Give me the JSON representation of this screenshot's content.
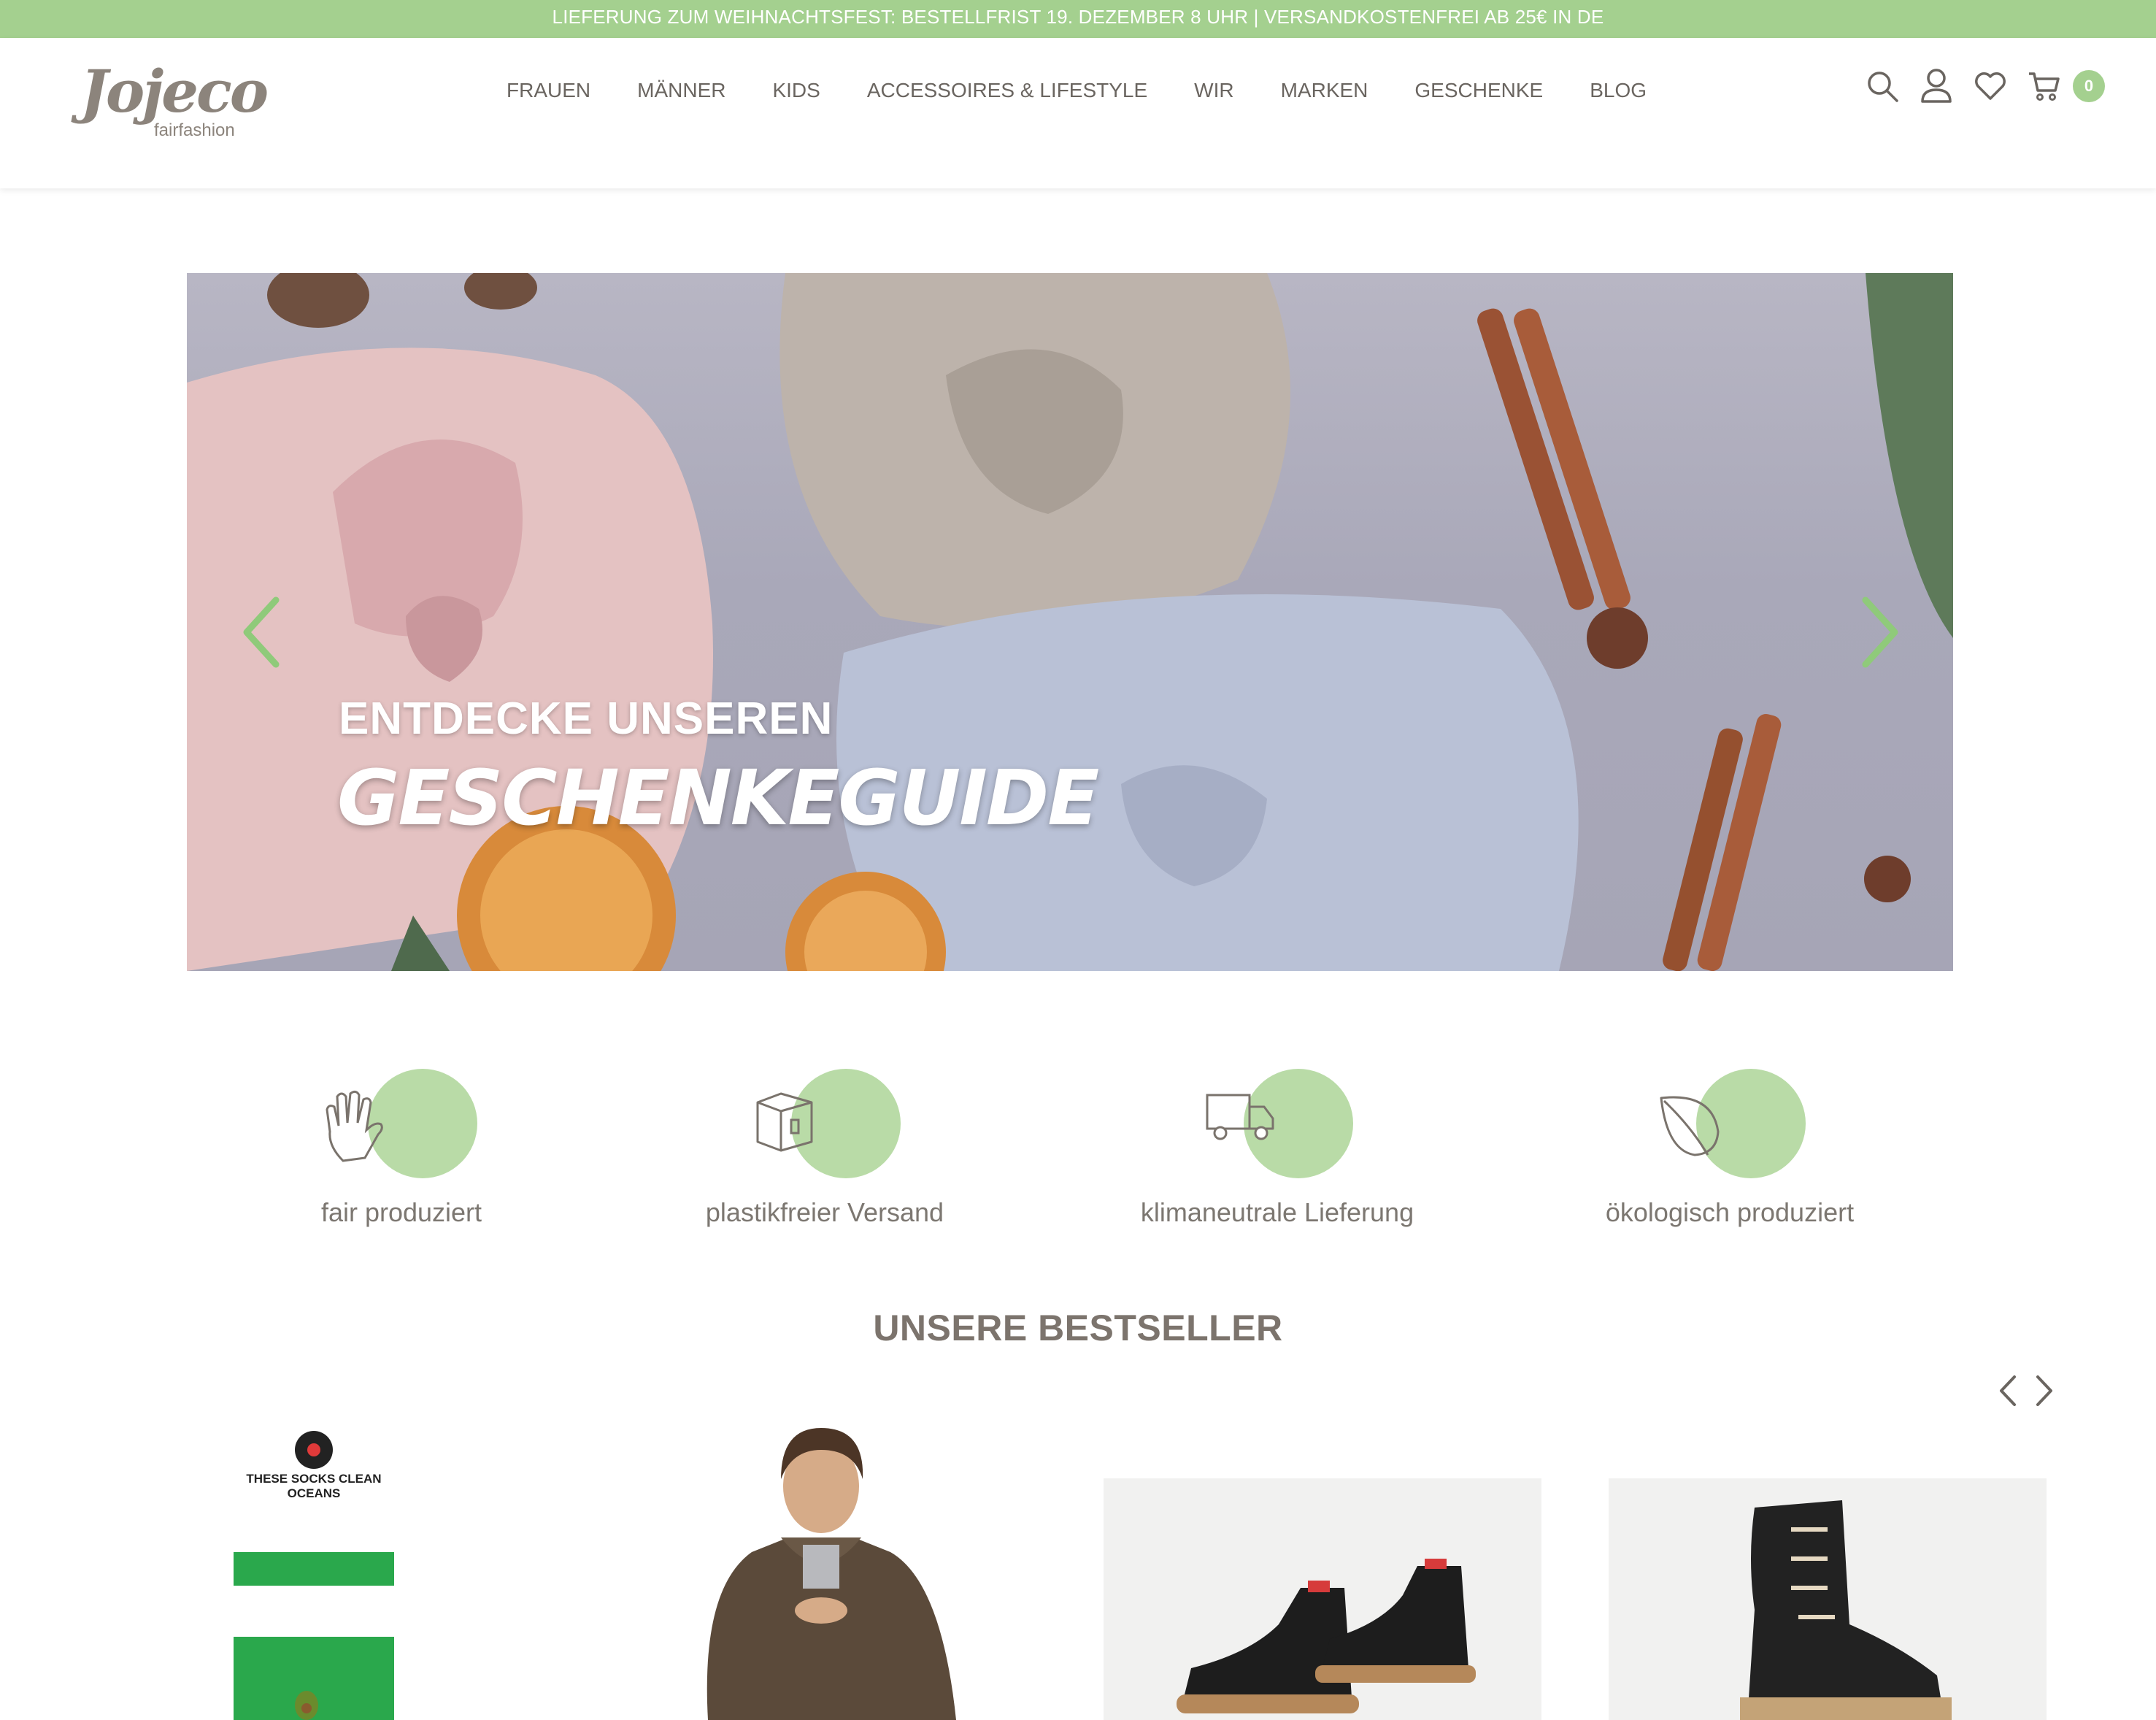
{
  "topbar": {
    "text": "LIEFERUNG ZUM WEIHNACHTSFEST: BESTELLFRIST 19. DEZEMBER 8 UHR | VERSANDKOSTENFREI AB 25€ IN DE"
  },
  "logo": {
    "wordmark": "Jojeco",
    "tagline": "fairfashion"
  },
  "nav": [
    {
      "label": "FRAUEN"
    },
    {
      "label": "MÄNNER"
    },
    {
      "label": "KIDS"
    },
    {
      "label": "ACCESSOIRES & LIFESTYLE"
    },
    {
      "label": "WIR"
    },
    {
      "label": "MARKEN"
    },
    {
      "label": "GESCHENKE"
    },
    {
      "label": "BLOG"
    }
  ],
  "header_icons": [
    "search-icon",
    "user-icon",
    "heart-icon",
    "cart-icon"
  ],
  "cart": {
    "count": "0"
  },
  "hero": {
    "line1": "ENTDECKE UNSEREN",
    "line2": "GESCHENKEGUIDE"
  },
  "features": [
    {
      "label": "fair produziert",
      "icon": "hand-icon"
    },
    {
      "label": "plastikfreier Versand",
      "icon": "box-icon"
    },
    {
      "label": "klimaneutrale Lieferung",
      "icon": "truck-icon"
    },
    {
      "label": "ökologisch produziert",
      "icon": "leaf-icon"
    }
  ],
  "bestsellers": {
    "title": "UNSERE BESTSELLER"
  },
  "products": {
    "socks_label": "THESE SOCKS CLEAN OCEANS"
  },
  "colors": {
    "accent": "#a4d08f",
    "accent_blob": "#b9dba7",
    "text": "#6f6a64"
  }
}
